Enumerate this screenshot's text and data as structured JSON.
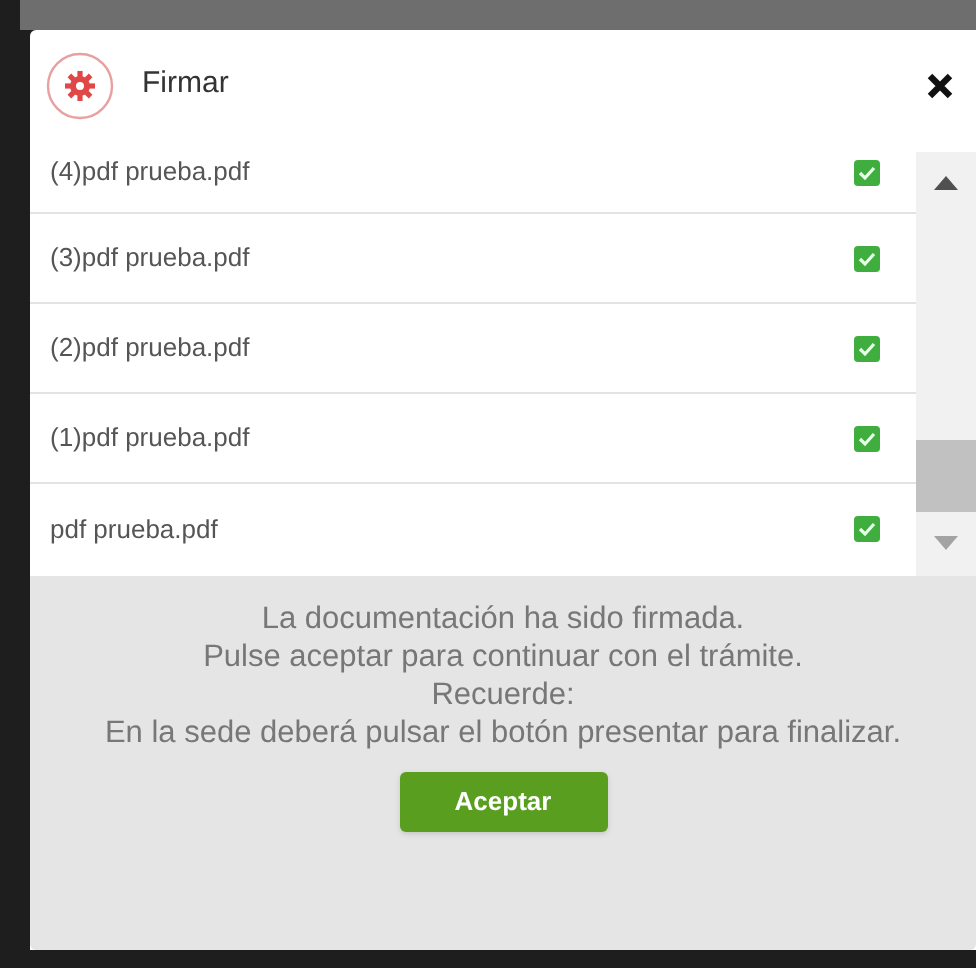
{
  "dialog": {
    "title": "Firmar"
  },
  "files": [
    {
      "name": "(4)pdf prueba.pdf",
      "checked": true
    },
    {
      "name": "(3)pdf prueba.pdf",
      "checked": true
    },
    {
      "name": "(2)pdf prueba.pdf",
      "checked": true
    },
    {
      "name": "(1)pdf prueba.pdf",
      "checked": true
    },
    {
      "name": "pdf prueba.pdf",
      "checked": true
    }
  ],
  "message": {
    "lines": [
      "La documentación ha sido firmada.",
      "Pulse aceptar para continuar con el trámite.",
      "Recuerde:",
      "En la sede deberá pulsar el botón presentar para finalizar."
    ]
  },
  "buttons": [
    {
      "label": "Aceptar"
    }
  ]
}
